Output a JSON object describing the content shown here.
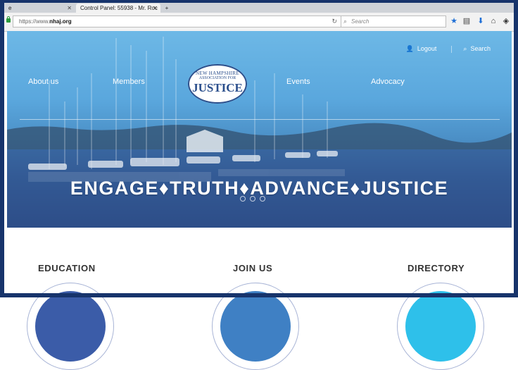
{
  "browser": {
    "tabs": [
      {
        "label": "e"
      },
      {
        "label": "Control Panel: 55938 - Mr. Roc"
      }
    ],
    "url_prefix": "https://www.",
    "url_host": "nhaj.org",
    "search_placeholder": "Search"
  },
  "site": {
    "top_links": {
      "logout": "Logout",
      "search": "Search"
    },
    "nav": {
      "about": "About us",
      "members": "Members",
      "events": "Events",
      "advocacy": "Advocacy"
    },
    "logo": {
      "line1": "NEW HAMPSHIRE",
      "line2": "ASSOCIATION FOR",
      "line3": "JUSTICE"
    },
    "tagline": "ENGAGE♦TRUTH♦ADVANCE♦JUSTICE",
    "sections": [
      {
        "title": "EDUCATION",
        "color": "#3b5ca8"
      },
      {
        "title": "JOIN US",
        "color": "#3f80c4"
      },
      {
        "title": "DIRECTORY",
        "color": "#2ec0ea"
      }
    ]
  },
  "colors": {
    "frame": "#17346b",
    "toolbar_star": "#1f6fd6"
  }
}
